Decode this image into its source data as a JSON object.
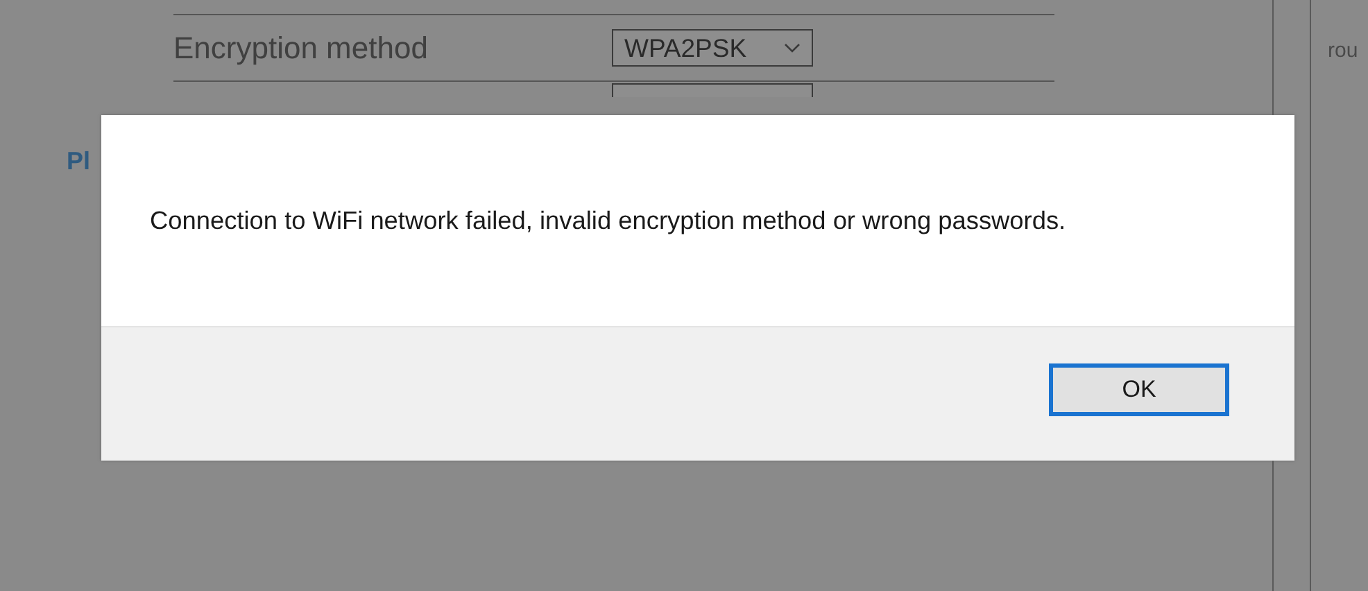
{
  "settings": {
    "rows": [
      {
        "label": "Encryption method",
        "value": "WPA2PSK",
        "kind": "select"
      }
    ],
    "heading": "Pl"
  },
  "side_panel": {
    "text": "rou"
  },
  "dialog": {
    "message": "Connection to WiFi network failed, invalid encryption method or wrong passwords.",
    "buttons": [
      {
        "label": "OK",
        "focused": true
      }
    ]
  }
}
